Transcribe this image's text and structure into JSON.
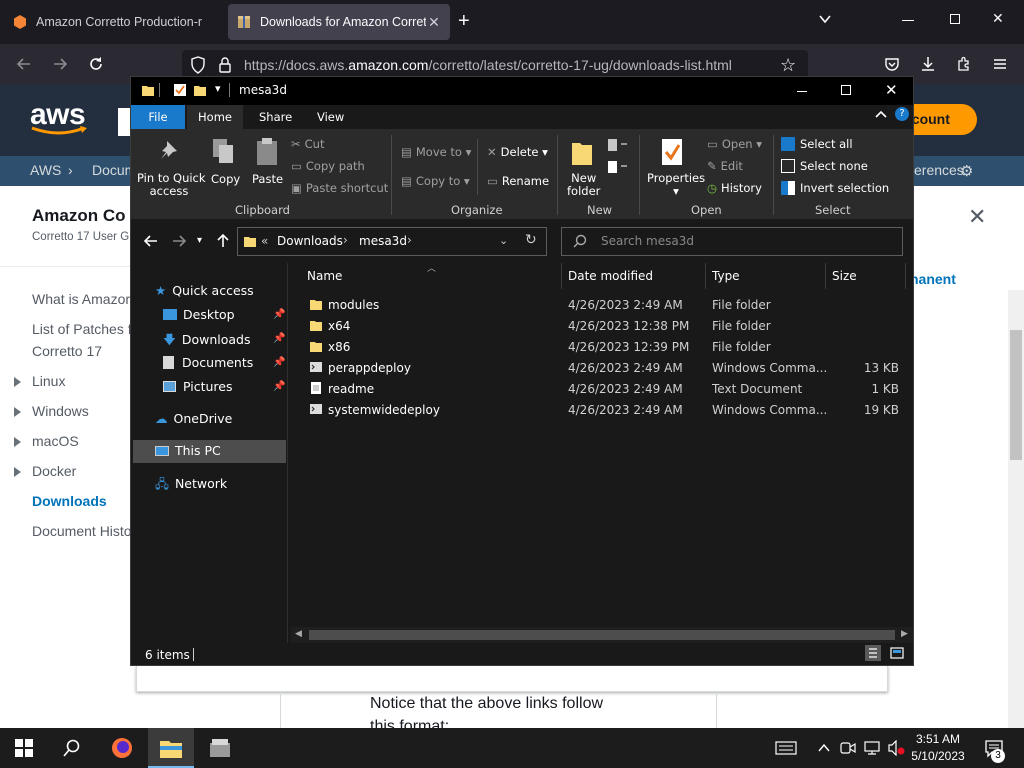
{
  "browser": {
    "tabs": [
      {
        "label": "Amazon Corretto Production-r",
        "active": false
      },
      {
        "label": "Downloads for Amazon Corretto",
        "active": true
      }
    ],
    "url_prefix": "https://docs.aws.",
    "url_domain": "amazon.com",
    "url_suffix": "/corretto/latest/corretto-17-ug/downloads-list.html"
  },
  "aws": {
    "logo": "aws",
    "account_button": "ccount",
    "breadcrumb": [
      "AWS",
      "Docum"
    ],
    "breadcrumb_right": "erences",
    "title": "Amazon Co",
    "subtitle": "Corretto 17 User G",
    "nav": [
      {
        "label": "What is Amazor",
        "expandable": false
      },
      {
        "label": "List of Patches f",
        "expandable": false
      },
      {
        "label": "Corretto 17",
        "expandable": false
      },
      {
        "label": "Linux",
        "expandable": true
      },
      {
        "label": "Windows",
        "expandable": true
      },
      {
        "label": "macOS",
        "expandable": true
      },
      {
        "label": "Docker",
        "expandable": true
      },
      {
        "label": "Downloads",
        "expandable": false,
        "active": true
      },
      {
        "label": "Document Histo",
        "expandable": false
      }
    ],
    "right_link": "nanent",
    "notice": "Notice that the above links follow",
    "notice_cont": "this format:"
  },
  "explorer": {
    "title": "mesa3d",
    "ribbon_tabs": [
      "File",
      "Home",
      "Share",
      "View"
    ],
    "clipboard": {
      "pin": [
        "Pin to Quick",
        "access"
      ],
      "copy": "Copy",
      "paste": "Paste",
      "cut": "Cut",
      "copy_path": "Copy path",
      "paste_shortcut": "Paste shortcut",
      "group": "Clipboard"
    },
    "organize": {
      "move_to": "Move to",
      "copy_to": "Copy to",
      "delete": "Delete",
      "rename": "Rename",
      "group": "Organize"
    },
    "new": {
      "new_folder": [
        "New",
        "folder"
      ],
      "group": "New"
    },
    "open": {
      "properties": "Properties",
      "open": "Open",
      "edit": "Edit",
      "history": "History",
      "group": "Open"
    },
    "select": {
      "select_all": "Select all",
      "select_none": "Select none",
      "invert": "Invert selection",
      "group": "Select"
    },
    "address": {
      "prefix": "«",
      "parts": [
        "Downloads",
        "mesa3d"
      ]
    },
    "search_placeholder": "Search mesa3d",
    "nav_pane": [
      {
        "label": "Quick access",
        "icon": "star-icon"
      },
      {
        "label": "Desktop",
        "icon": "desktop-icon",
        "pinned": true
      },
      {
        "label": "Downloads",
        "icon": "download-icon",
        "pinned": true
      },
      {
        "label": "Documents",
        "icon": "documents-icon",
        "pinned": true
      },
      {
        "label": "Pictures",
        "icon": "pictures-icon",
        "pinned": true
      },
      {
        "label": "OneDrive",
        "icon": "cloud-icon"
      },
      {
        "label": "This PC",
        "icon": "pc-icon",
        "selected": true
      },
      {
        "label": "Network",
        "icon": "network-icon"
      }
    ],
    "columns": [
      "Name",
      "Date modified",
      "Type",
      "Size"
    ],
    "files": [
      {
        "name": "modules",
        "date": "4/26/2023 2:49 AM",
        "type": "File folder",
        "size": "",
        "icon": "folder-icon"
      },
      {
        "name": "x64",
        "date": "4/26/2023 12:38 PM",
        "type": "File folder",
        "size": "",
        "icon": "folder-icon"
      },
      {
        "name": "x86",
        "date": "4/26/2023 12:39 PM",
        "type": "File folder",
        "size": "",
        "icon": "folder-icon"
      },
      {
        "name": "perappdeploy",
        "date": "4/26/2023 2:49 AM",
        "type": "Windows Comma...",
        "size": "13 KB",
        "icon": "script-icon"
      },
      {
        "name": "readme",
        "date": "4/26/2023 2:49 AM",
        "type": "Text Document",
        "size": "1 KB",
        "icon": "text-file-icon"
      },
      {
        "name": "systemwidedeploy",
        "date": "4/26/2023 2:49 AM",
        "type": "Windows Comma...",
        "size": "19 KB",
        "icon": "script-icon"
      }
    ],
    "status": "6 items"
  },
  "taskbar": {
    "time": "3:51 AM",
    "date": "5/10/2023",
    "notifications": "3"
  },
  "colors": {
    "aws_orange": "#ff9900",
    "aws_dark": "#232f3e",
    "explorer_bg": "#191919",
    "ribbon_blue": "#1979ca",
    "folder_yellow": "#f8d775",
    "link_blue": "#0073bb"
  }
}
